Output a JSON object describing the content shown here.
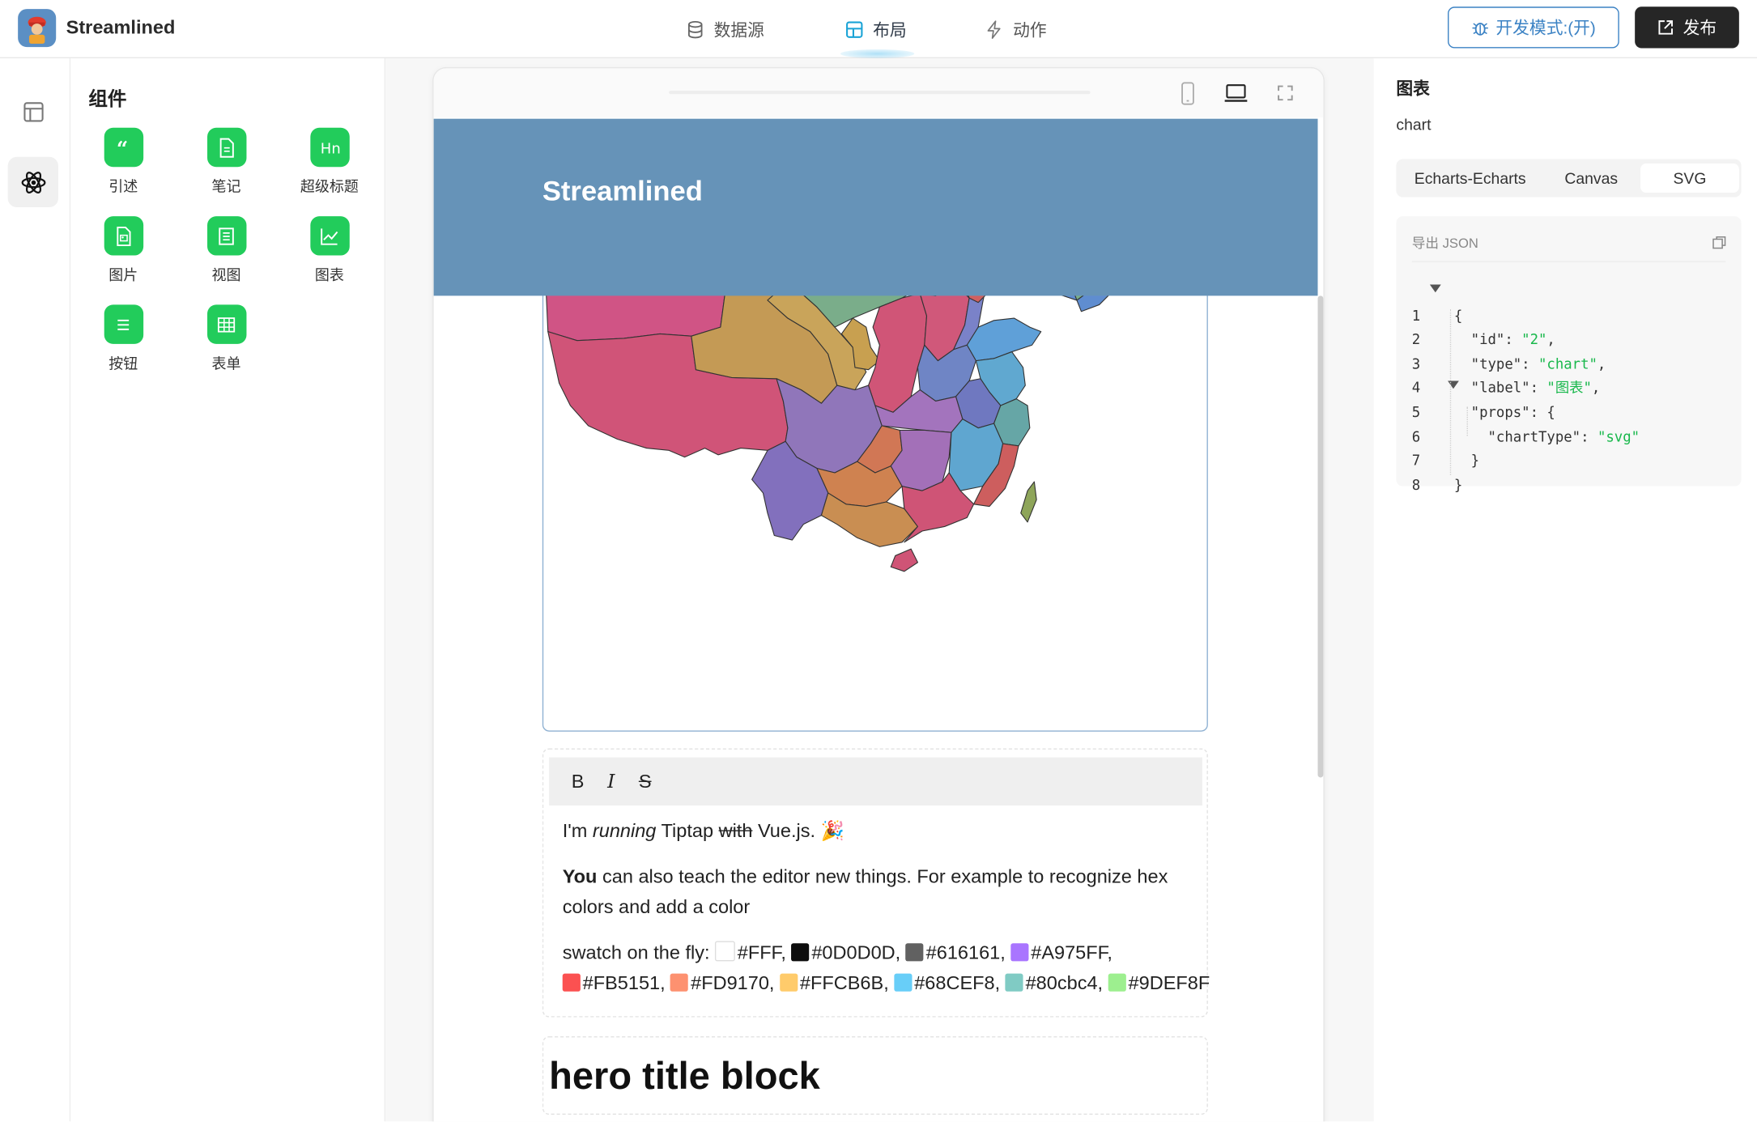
{
  "app": {
    "title": "Streamlined"
  },
  "nav": {
    "tabs": [
      {
        "label": "数据源",
        "icon": "database-icon"
      },
      {
        "label": "布局",
        "icon": "layout-icon",
        "active": true
      },
      {
        "label": "动作",
        "icon": "lightning-icon"
      }
    ]
  },
  "actions": {
    "dev_mode_label": "开发模式:(开)",
    "publish_label": "发布"
  },
  "rail": {
    "items": [
      {
        "icon": "layout-panel-icon"
      },
      {
        "icon": "atom-icon",
        "active": true
      }
    ]
  },
  "components": {
    "title": "组件",
    "items": [
      {
        "label": "引述",
        "icon": "quote-icon"
      },
      {
        "label": "笔记",
        "icon": "note-icon"
      },
      {
        "label": "超级标题",
        "icon": "heading-icon"
      },
      {
        "label": "图片",
        "icon": "image-icon"
      },
      {
        "label": "视图",
        "icon": "view-icon"
      },
      {
        "label": "图表",
        "icon": "chart-icon"
      },
      {
        "label": "按钮",
        "icon": "button-icon"
      },
      {
        "label": "表单",
        "icon": "table-icon"
      }
    ]
  },
  "preview": {
    "header_title": "Streamlined",
    "editor": {
      "toolbar": [
        "B",
        "I",
        "S"
      ],
      "line1": {
        "prefix": "I'm ",
        "italic": "running",
        "middle": " Tiptap ",
        "strike": "with",
        "suffix": " Vue.js. 🎉"
      },
      "line2": {
        "bold": "You",
        "rest": " can also teach the editor new things. For example to recognize hex"
      },
      "line3": "colors and add a color",
      "swatch_prefix": "swatch on the fly:",
      "swatches": [
        {
          "label": "#FFF",
          "color": "#FFFFFF"
        },
        {
          "label": "#0D0D0D",
          "color": "#0D0D0D"
        },
        {
          "label": "#616161",
          "color": "#616161"
        },
        {
          "label": "#A975FF",
          "color": "#A975FF"
        },
        {
          "label": "#FB5151",
          "color": "#FB5151"
        },
        {
          "label": "#FD9170",
          "color": "#FD9170"
        },
        {
          "label": "#FFCB6B",
          "color": "#FFCB6B"
        },
        {
          "label": "#68CEF8",
          "color": "#68CEF8"
        },
        {
          "label": "#80cbc4",
          "color": "#80CBC4"
        },
        {
          "label": "#9DEF8F",
          "color": "#9DEF8F"
        }
      ]
    },
    "hero_title": "hero title block"
  },
  "props_panel": {
    "title": "图表",
    "subtitle": "chart",
    "segments": [
      {
        "label": "Echarts-Echarts"
      },
      {
        "label": "Canvas"
      },
      {
        "label": "SVG",
        "active": true
      }
    ],
    "json_header": "导出 JSON",
    "json_lines": [
      {
        "n": "1",
        "text": "{"
      },
      {
        "n": "2",
        "key": "\"id\"",
        "value": "\"2\""
      },
      {
        "n": "3",
        "key": "\"type\"",
        "value": "\"chart\""
      },
      {
        "n": "4",
        "key": "\"label\"",
        "value": "\"图表\""
      },
      {
        "n": "5",
        "text": "\"props\": {"
      },
      {
        "n": "6",
        "key": "\"chartType\"",
        "value": "\"svg\""
      },
      {
        "n": "7",
        "text": "}"
      },
      {
        "n": "8",
        "text": "}"
      }
    ]
  }
}
